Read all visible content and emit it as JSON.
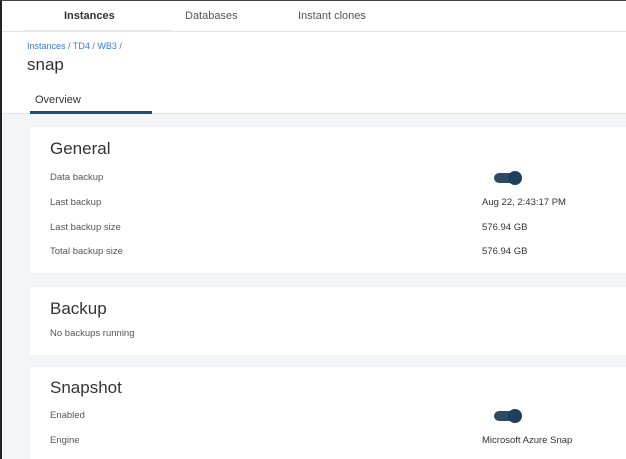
{
  "top_tabs": [
    {
      "label": "Instances",
      "active": true
    },
    {
      "label": "Databases",
      "active": false
    },
    {
      "label": "Instant clones",
      "active": false
    }
  ],
  "breadcrumb": "Instances / TD4 / WB3 /",
  "page_title": "snap",
  "sub_tabs": [
    {
      "label": "Overview",
      "active": true
    }
  ],
  "general": {
    "title": "General",
    "rows": [
      {
        "label": "Data backup",
        "toggle": true
      },
      {
        "label": "Last backup",
        "value": "Aug 22, 2:43:17 PM"
      },
      {
        "label": "Last backup size",
        "value": "576.94 GB"
      },
      {
        "label": "Total backup size",
        "value": "576.94 GB"
      }
    ]
  },
  "backup": {
    "title": "Backup",
    "status": "No backups running"
  },
  "snapshot": {
    "title": "Snapshot",
    "rows": [
      {
        "label": "Enabled",
        "toggle": true
      },
      {
        "label": "Engine",
        "value": "Microsoft Azure Snap"
      }
    ]
  },
  "colors": {
    "accent": "#1f4e79",
    "link": "#3a7bd5",
    "toggle_on": "#2f4a62",
    "background": "#f4f5f7"
  }
}
